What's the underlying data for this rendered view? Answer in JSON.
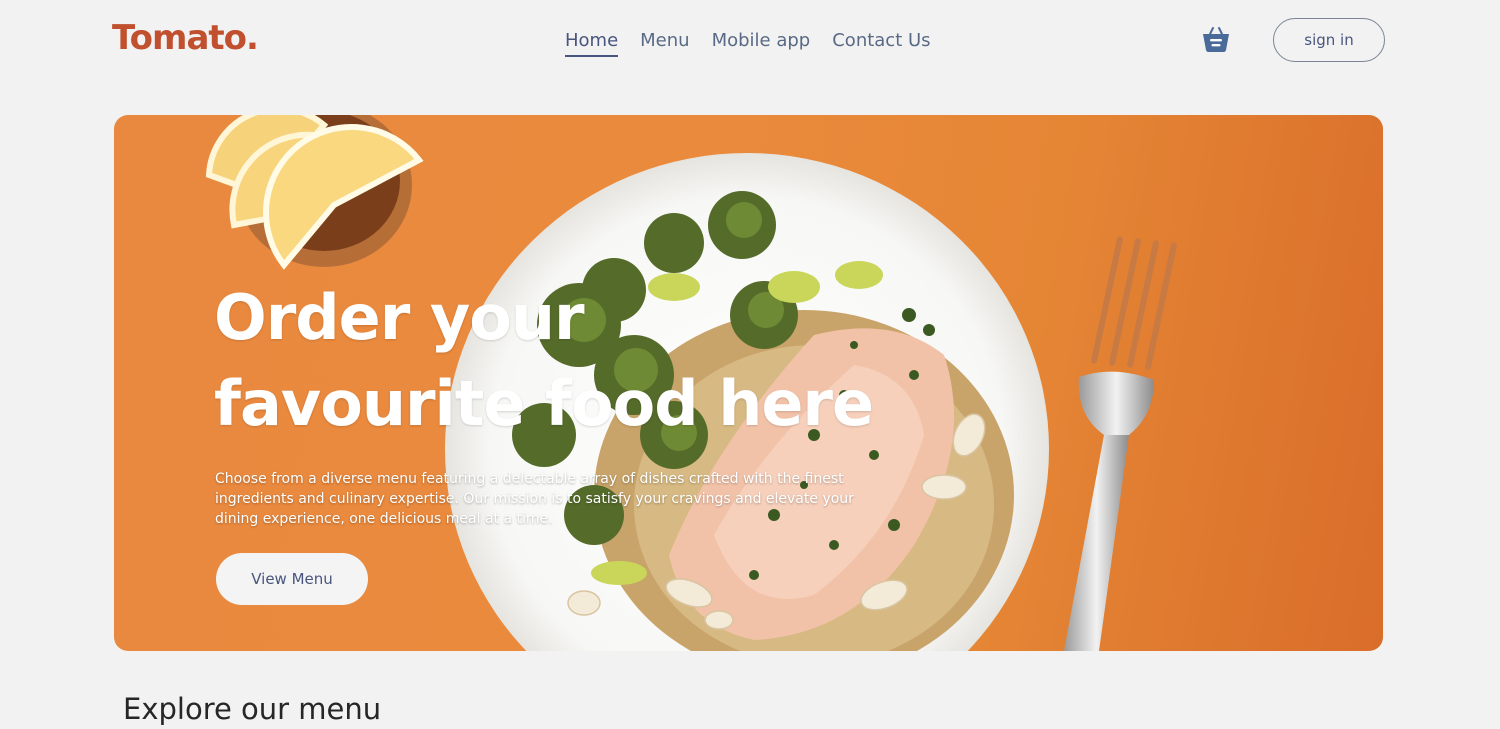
{
  "brand": {
    "logo_text": "Tomato.",
    "accent_color": "#c0502e"
  },
  "navbar": {
    "links": [
      {
        "label": "Home",
        "active": true
      },
      {
        "label": "Menu",
        "active": false
      },
      {
        "label": "Mobile app",
        "active": false
      },
      {
        "label": "Contact Us",
        "active": false
      }
    ],
    "basket_icon": "basket-icon",
    "sign_in_label": "sign in"
  },
  "hero": {
    "title_line1": "Order your",
    "title_line2": "favourite food here",
    "description": "Choose from a diverse menu featuring a delectable array of dishes crafted with the finest ingredients and culinary expertise. Our mission is to satisfy your cravings and elevate your dining experience, one delicious meal at a time.",
    "cta_label": "View Menu",
    "background_color": "#e98940"
  },
  "explore": {
    "title": "Explore our menu"
  }
}
